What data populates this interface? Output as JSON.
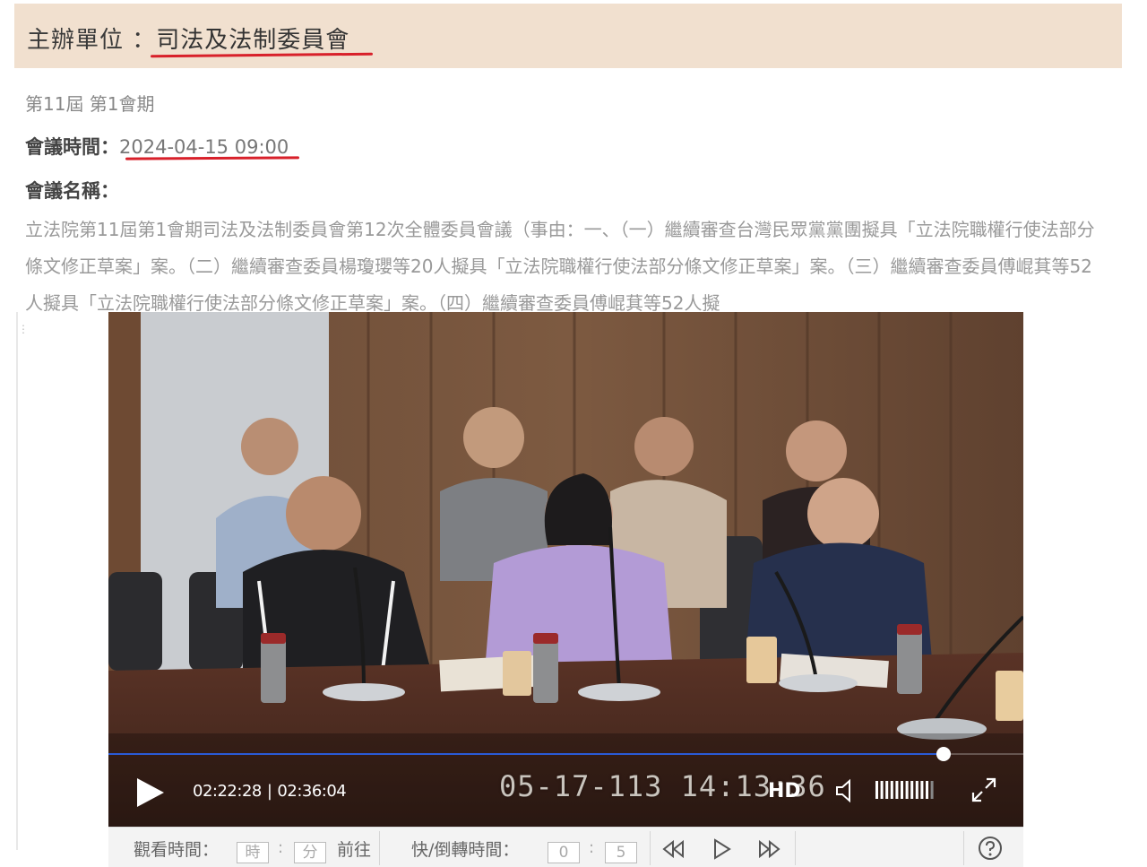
{
  "header": {
    "label": "主辦單位 ：",
    "value": "司法及法制委員會"
  },
  "session": "第11屆 第1會期",
  "meeting_time": {
    "label": "會議時間：",
    "value": "2024-04-15 09:00"
  },
  "meeting_name": {
    "label": "會議名稱："
  },
  "description": "立法院第11屆第1會期司法及法制委員會第12次全體委員會議（事由：一、（一）繼續審查台灣民眾黨黨團擬具「立法院職權行使法部分條文修正草案」案。（二）繼續審查委員楊瓊瓔等20人擬具「立法院職權行使法部分條文修正草案」案。（三）繼續審查委員傅崐萁等52人擬具「立法院職權行使法部分條文修正草案」案。（四）繼續審查委員傅崐萁等52人擬",
  "ellipsis": "⋮",
  "video": {
    "overlay_stamp": "05-17-113  14:13:36",
    "current_time": "02:22:28",
    "separator": "|",
    "total_time": "02:36:04",
    "progress": 0.913,
    "hd_label": "HD",
    "volume_level": 0.9
  },
  "controls": {
    "watch_time_label": "觀看時間：",
    "hour_placeholder": "時",
    "minute_placeholder": "分",
    "go_label": "前往",
    "skip_time_label": "快/倒轉時間：",
    "skip_min": "0",
    "skip_sec": "5",
    "colon": ":"
  },
  "colors": {
    "accent_red": "#d8202a",
    "progress_blue": "#2a5bd7",
    "header_bg": "#f1e0cf"
  }
}
